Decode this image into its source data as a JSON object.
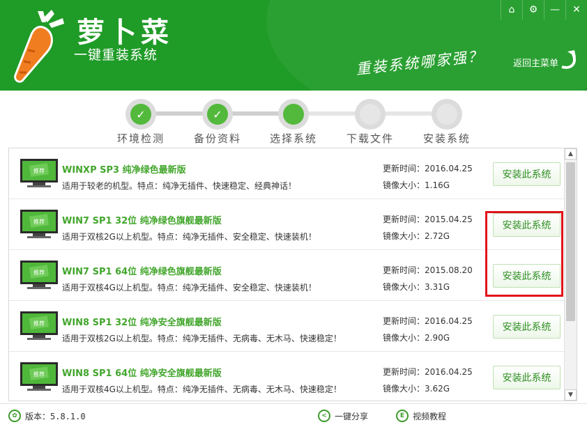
{
  "header": {
    "brand": "萝卜菜",
    "subtitle": "一键重装系统",
    "slogan": "重装系统哪家强？",
    "back_main": "返回主菜单",
    "controls": {
      "home": "⌂",
      "settings": "⚙",
      "minimize": "—",
      "close": "✕"
    }
  },
  "steps": [
    {
      "label": "环境检测",
      "state": "done"
    },
    {
      "label": "备份资料",
      "state": "done"
    },
    {
      "label": "选择系统",
      "state": "active"
    },
    {
      "label": "下载文件",
      "state": "pending"
    },
    {
      "label": "安装系统",
      "state": "pending"
    }
  ],
  "badge": "推荐",
  "list": [
    {
      "title": "WINXP SP3 纯净绿色最新版",
      "desc": "适用于较老的机型。特点：纯净无插件、快速稳定、经典神话！",
      "update": "更新时间：2016.04.25",
      "size": "镜像大小：1.16G",
      "button": "安装此系统"
    },
    {
      "title": "WIN7 SP1 32位 纯净绿色旗舰最新版",
      "desc": "适用于双核2G以上机型。特点：纯净无插件、安全稳定、快速装机！",
      "update": "更新时间：2015.04.25",
      "size": "镜像大小：2.72G",
      "button": "安装此系统"
    },
    {
      "title": "WIN7 SP1 64位 纯净绿色旗舰最新版",
      "desc": "适用于双核4G以上机型。特点：纯净无插件、安全稳定、快速装机！",
      "update": "更新时间：2015.08.20",
      "size": "镜像大小：3.31G",
      "button": "安装此系统"
    },
    {
      "title": "WIN8 SP1 32位 纯净安全旗舰最新版",
      "desc": "适用于双核2G以上机型。特点：纯净无插件、无病毒、无木马、快速稳定！",
      "update": "更新时间：2016.04.25",
      "size": "镜像大小：2.90G",
      "button": "安装此系统"
    },
    {
      "title": "WIN8 SP1 64位 纯净安全旗舰最新版",
      "desc": "适用于双核4G以上机型。特点：纯净无插件、无病毒、无木马、快速稳定！",
      "update": "更新时间：2016.04.25",
      "size": "镜像大小：3.62G",
      "button": "安装此系统"
    }
  ],
  "footer": {
    "version": "版本：5.8.1.0",
    "share": "一键分享",
    "tutorial": "视频教程"
  },
  "colors": {
    "brand_green": "#1f9b27",
    "accent_green": "#42a62c",
    "highlight_red": "#e3121a"
  }
}
